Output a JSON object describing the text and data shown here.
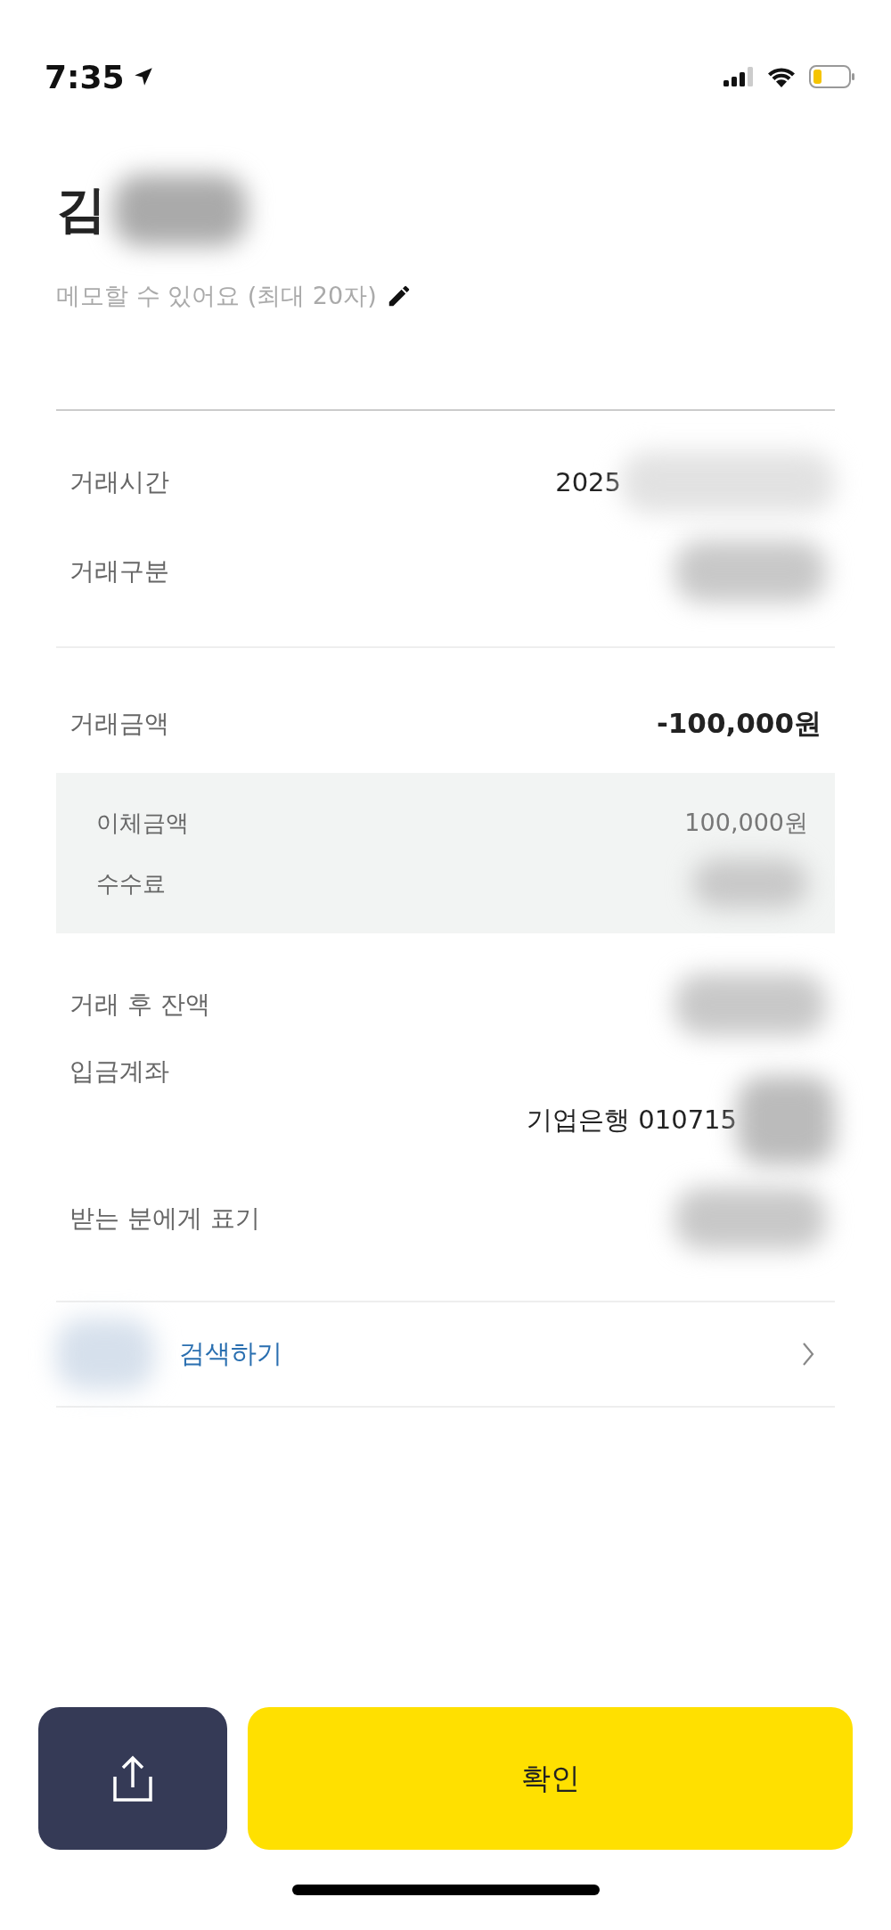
{
  "status_bar": {
    "time": "7:35"
  },
  "header": {
    "name": "김",
    "name_redacted": true,
    "memo_hint": "메모할 수 있어요 (최대 20자)"
  },
  "details": [
    {
      "label": "거래시간",
      "value": "2025",
      "redacted": true
    },
    {
      "label": "거래구분",
      "redacted": true
    }
  ],
  "amount": {
    "label": "거래금액",
    "value": "-100,000원"
  },
  "breakdown": [
    {
      "label": "이체금액",
      "value": "100,000원",
      "redacted": false
    },
    {
      "label": "수수료",
      "redacted": true
    }
  ],
  "after": [
    {
      "kind": "inline",
      "label": "거래 후 잔액",
      "redacted": true
    },
    {
      "kind": "stacked",
      "label": "입금계좌",
      "value": "기업은행 010715",
      "redacted": true
    },
    {
      "kind": "inline",
      "label": "받는 분에게 표기",
      "redacted": true
    }
  ],
  "search_link": {
    "label": "검색하기",
    "redacted": true
  },
  "buttons": {
    "confirm": "확인"
  }
}
